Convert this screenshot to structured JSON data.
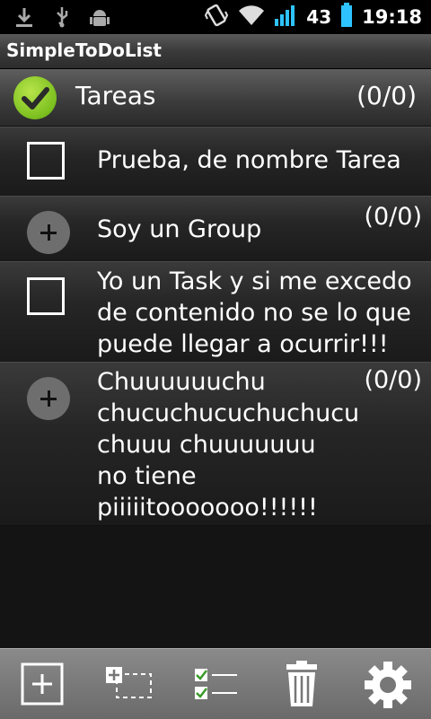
{
  "status_bar": {
    "battery_level": "43",
    "time": "19:18",
    "icons": [
      "download-icon",
      "usb-icon",
      "android-debug-icon",
      "vibrate-icon",
      "wifi-icon",
      "signal-icon",
      "battery-icon"
    ]
  },
  "app": {
    "title": "SimpleToDoList"
  },
  "list_header": {
    "title": "Tareas",
    "count": "(0/0)",
    "accent": "#7bbf1f"
  },
  "items": [
    {
      "type": "task",
      "text": "Prueba, de nombre Tarea"
    },
    {
      "type": "group",
      "text": "Soy un Group",
      "count": "(0/0)"
    },
    {
      "type": "task",
      "text": "Yo un Task y si me excedo\nde contenido no se lo que\npuede llegar a ocurrir!!!"
    },
    {
      "type": "group",
      "text": "Chuuuuuuchu\nchucuchucuchuchucu\n chuuu chuuuuuuu\nno tiene\npiiiiitooooooo!!!!!!",
      "count": "(0/0)"
    }
  ],
  "toolbar": {
    "buttons": [
      "add-task-icon",
      "add-group-icon",
      "checklist-icon",
      "trash-icon",
      "settings-gear-icon"
    ]
  }
}
